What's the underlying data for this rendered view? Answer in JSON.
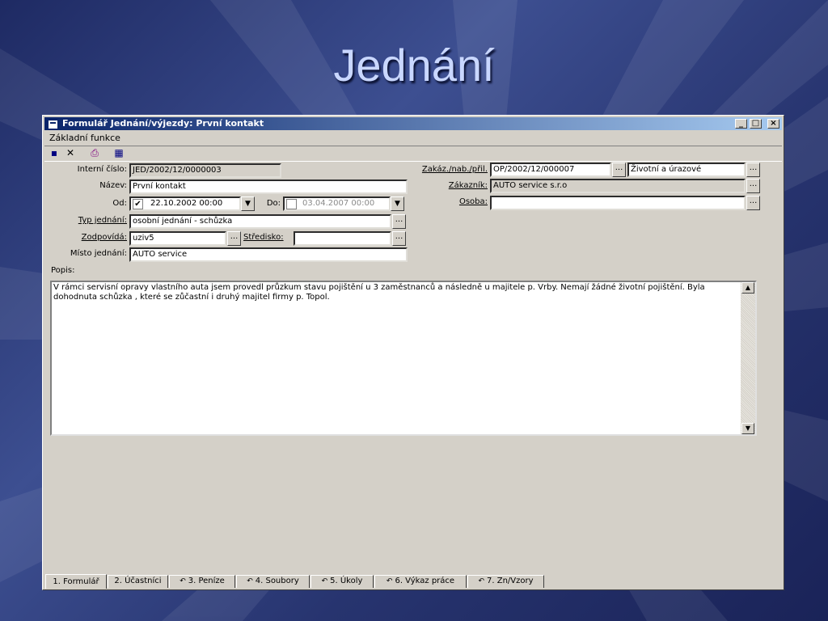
{
  "slide": {
    "title": "Jednání"
  },
  "window": {
    "title": "Formulář Jednání/výjezdy: První kontakt",
    "min_label": "_",
    "max_label": "□",
    "close_label": "×"
  },
  "menu": {
    "items": [
      "Základní funkce"
    ]
  },
  "toolbar": {
    "icons": [
      "save-icon",
      "delete-icon",
      "print-icon",
      "calendar-icon"
    ],
    "glyphs": [
      "▪",
      "✕",
      "⎙",
      "▦"
    ]
  },
  "form": {
    "interni_cislo": {
      "label": "Interní číslo:",
      "value": "JED/2002/12/0000003"
    },
    "nazev": {
      "label": "Název:",
      "value": "První kontakt"
    },
    "od": {
      "label": "Od:",
      "value": "22.10.2002 00:00",
      "checked": "✔"
    },
    "do": {
      "label": "Do:",
      "value": "03.04.2007 00:00"
    },
    "typ_jednani": {
      "label": "Typ jednání:",
      "value": "osobní jednání - schůzka"
    },
    "zodpovida": {
      "label": "Zodpovídá:",
      "value": "uziv5"
    },
    "stredisko": {
      "label": "Středisko:",
      "value": ""
    },
    "misto_jednani": {
      "label": "Místo jednání:",
      "value": "AUTO service"
    },
    "zakaz": {
      "label": "Zakáz./nab./přil.",
      "value": "OP/2002/12/000007",
      "value2": "Životní a úrazové"
    },
    "zakaznik": {
      "label": "Zákazník:",
      "value": "AUTO service s.r.o"
    },
    "osoba": {
      "label": "Osoba:",
      "value": ""
    },
    "popis": {
      "label": "Popis:",
      "value": "V rámci servisní opravy vlastního auta jsem provedl průzkum stavu pojištění u 3 zaměstnanců a následně u majitele p. Vrby. Nemají žádné životní pojištění. Byla dohodnuta schůzka , které se zůčastní i druhý majitel firmy p. Topol."
    },
    "dots_label": "...",
    "dd_glyph": "▼",
    "up_glyph": "▲",
    "down_glyph": "▼"
  },
  "tabs": [
    {
      "label": "1. Formulář",
      "icon": ""
    },
    {
      "label": "2. Účastníci",
      "icon": ""
    },
    {
      "label": "3. Peníze",
      "icon": "↶"
    },
    {
      "label": "4. Soubory",
      "icon": "↶"
    },
    {
      "label": "5. Úkoly",
      "icon": "↶"
    },
    {
      "label": "6. Výkaz práce",
      "icon": "↶"
    },
    {
      "label": "7. Zn/Vzory",
      "icon": "↶"
    }
  ],
  "colors": {
    "accent": "#0a246a",
    "window_bg": "#d4d0c8",
    "slide_title": "#c9d7ff"
  }
}
